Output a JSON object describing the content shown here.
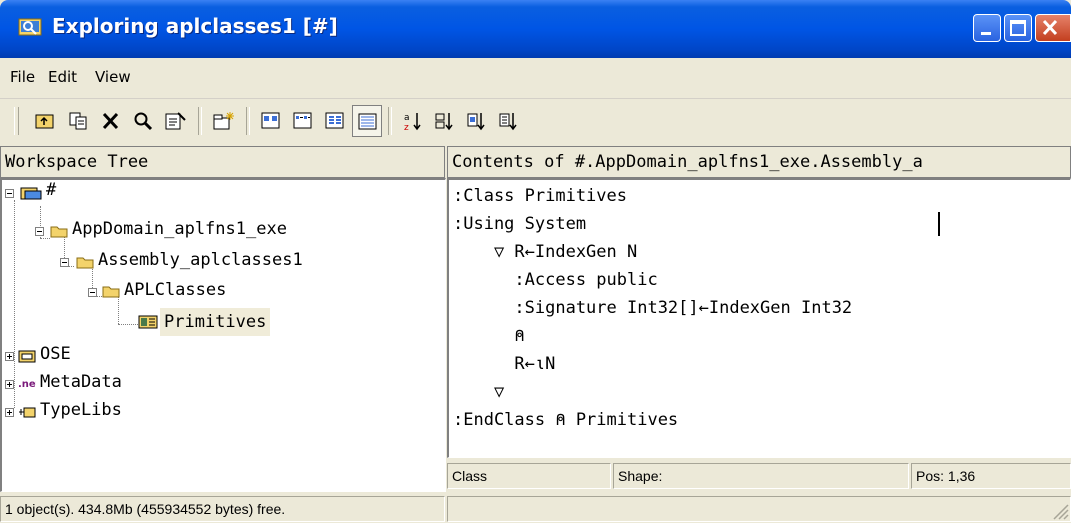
{
  "window": {
    "title": "Exploring aplclasses1 [#]",
    "controls": [
      "minimize",
      "maximize",
      "close"
    ]
  },
  "menu": [
    "File",
    "Edit",
    "View"
  ],
  "toolbar": {
    "buttons": [
      "up-one-level-icon",
      "copy-icon",
      "delete-icon",
      "find-icon",
      "properties-icon",
      "new-icon",
      "large-icons-icon",
      "small-icons-icon",
      "list-view-icon",
      "details-view-icon",
      "sort-by-name-icon",
      "sort-by-type-icon",
      "sort-by-size-icon",
      "sort-by-date-icon"
    ],
    "pressed": "details-view-icon"
  },
  "workspace_tree": {
    "header": "Workspace Tree",
    "nodes": [
      {
        "label": "#",
        "icon": "workspace-icon",
        "expanded": true
      },
      {
        "label": "AppDomain_aplfns1_exe",
        "icon": "folder-icon",
        "expanded": true
      },
      {
        "label": "Assembly_aplclasses1",
        "icon": "folder-icon",
        "expanded": true
      },
      {
        "label": "APLClasses",
        "icon": "folder-icon",
        "expanded": true
      },
      {
        "label": "Primitives",
        "icon": "class-icon",
        "selected": true
      },
      {
        "label": "OSE",
        "icon": "ose-icon",
        "expanded": false
      },
      {
        "label": "MetaData",
        "icon": "net-icon",
        "expanded": false
      },
      {
        "label": "TypeLibs",
        "icon": "typelib-icon",
        "expanded": false
      }
    ]
  },
  "contents": {
    "header": "Contents of #.AppDomain_aplfns1_exe.Assembly_a",
    "lines": [
      ":Class Primitives",
      ":Using System",
      "    ▽ R←IndexGen N",
      "      :Access public",
      "      :Signature Int32[]←IndexGen Int32",
      "      ⍝",
      "      R←⍳N",
      "    ▽",
      ":EndClass ⍝ Primitives"
    ]
  },
  "editor_status": {
    "type": "Class",
    "shape": "Shape:",
    "pos": "Pos: 1,36"
  },
  "status": {
    "free_memory": "1 object(s). 434.8Mb (455934552 bytes) free."
  },
  "colors": {
    "titlebar": "#0055e5",
    "chrome": "#ece9d8",
    "selection": "#f0ecd9",
    "close_button": "#c33f1f"
  }
}
